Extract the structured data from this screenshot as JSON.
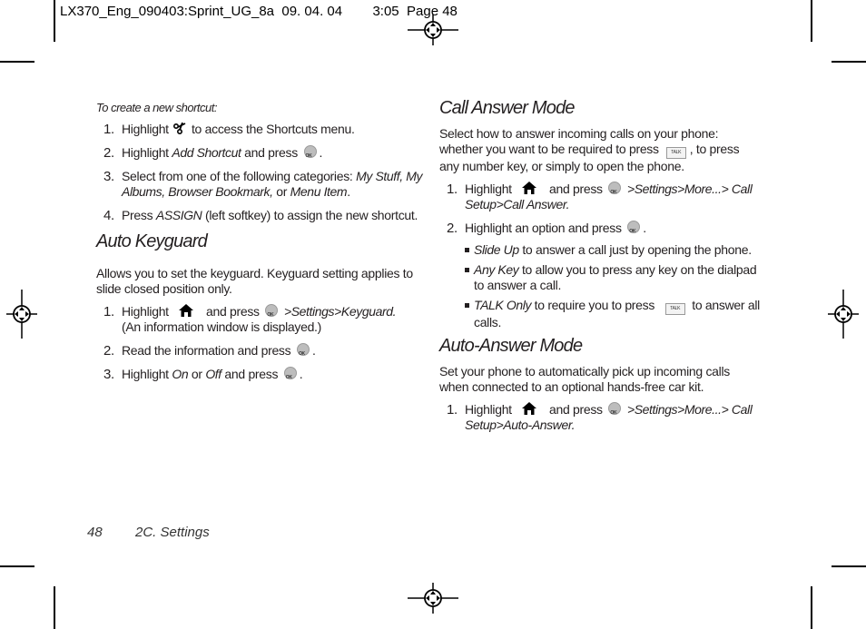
{
  "slug": {
    "file": "LX370_Eng_090403:Sprint_UG_8a",
    "date": "09. 04. 04",
    "time": "3:05",
    "page_label": "Page 48"
  },
  "left": {
    "shortcut_lead": "To create a new shortcut:",
    "shortcut_steps": [
      {
        "num": "1.",
        "pre": "Highlight",
        "post": "to access the Shortcuts menu."
      },
      {
        "num": "2.",
        "pre": "Highlight",
        "em": "Add Shortcut",
        "post": "and press",
        "end": "."
      },
      {
        "num": "3.",
        "pre": "Select from one of the following categories:",
        "em1": "My Stuff, My Albums, Browser Bookmark,",
        "mid": "or",
        "em2": "Menu Item",
        "end": "."
      },
      {
        "num": "4.",
        "pre": "Press",
        "em": "ASSIGN",
        "post": "(left softkey) to assign the new shortcut."
      }
    ],
    "keyguard": {
      "title": "Auto Keyguard",
      "intro": "Allows you to set the keyguard. Keyguard setting applies to slide closed position only.",
      "steps": [
        {
          "num": "1.",
          "pre": "Highlight",
          "mid": "and press",
          "path": ">Settings>Keyguard.",
          "post": "(An information window is displayed.)"
        },
        {
          "num": "2.",
          "pre": "Read the information and press",
          "end": "."
        },
        {
          "num": "3.",
          "pre": "Highlight",
          "em1": "On",
          "mid": "or",
          "em2": "Off",
          "post": "and press",
          "end": "."
        }
      ]
    }
  },
  "right": {
    "call_answer": {
      "title": "Call Answer Mode",
      "intro_a": "Select how to answer incoming calls on your phone: whether you want to be required to press",
      "intro_b": ", to press any number key, or simply to open the phone.",
      "talk_key": "TALK",
      "steps": [
        {
          "num": "1.",
          "pre": "Highlight",
          "mid": "and press",
          "path": ">Settings>More...> Call Setup>Call Answer."
        },
        {
          "num": "2.",
          "pre": "Highlight an option and press",
          "end": "."
        }
      ],
      "options": [
        {
          "em": "Slide Up",
          "text": "to answer a call just by opening the phone."
        },
        {
          "em": "Any Key",
          "text": "to allow you to press any key on the dialpad to answer a call."
        },
        {
          "em": "TALK Only",
          "text": "to require you to press",
          "post": "to answer all calls."
        }
      ]
    },
    "auto_answer": {
      "title": "Auto-Answer Mode",
      "intro": "Set your phone to automatically pick up incoming calls when connected to an optional hands-free car kit.",
      "steps": [
        {
          "num": "1.",
          "pre": "Highlight",
          "mid": "and press",
          "path": ">Settings>More...> Call Setup>Auto-Answer."
        }
      ]
    }
  },
  "footer": {
    "page_number": "48",
    "section": "2C. Settings"
  },
  "icons": {
    "ok_key": "menu-ok-key-icon",
    "talk_key": "talk-key-icon",
    "home": "home-icon",
    "shortcut": "shortcut-icon",
    "registration": "registration-mark-icon"
  }
}
